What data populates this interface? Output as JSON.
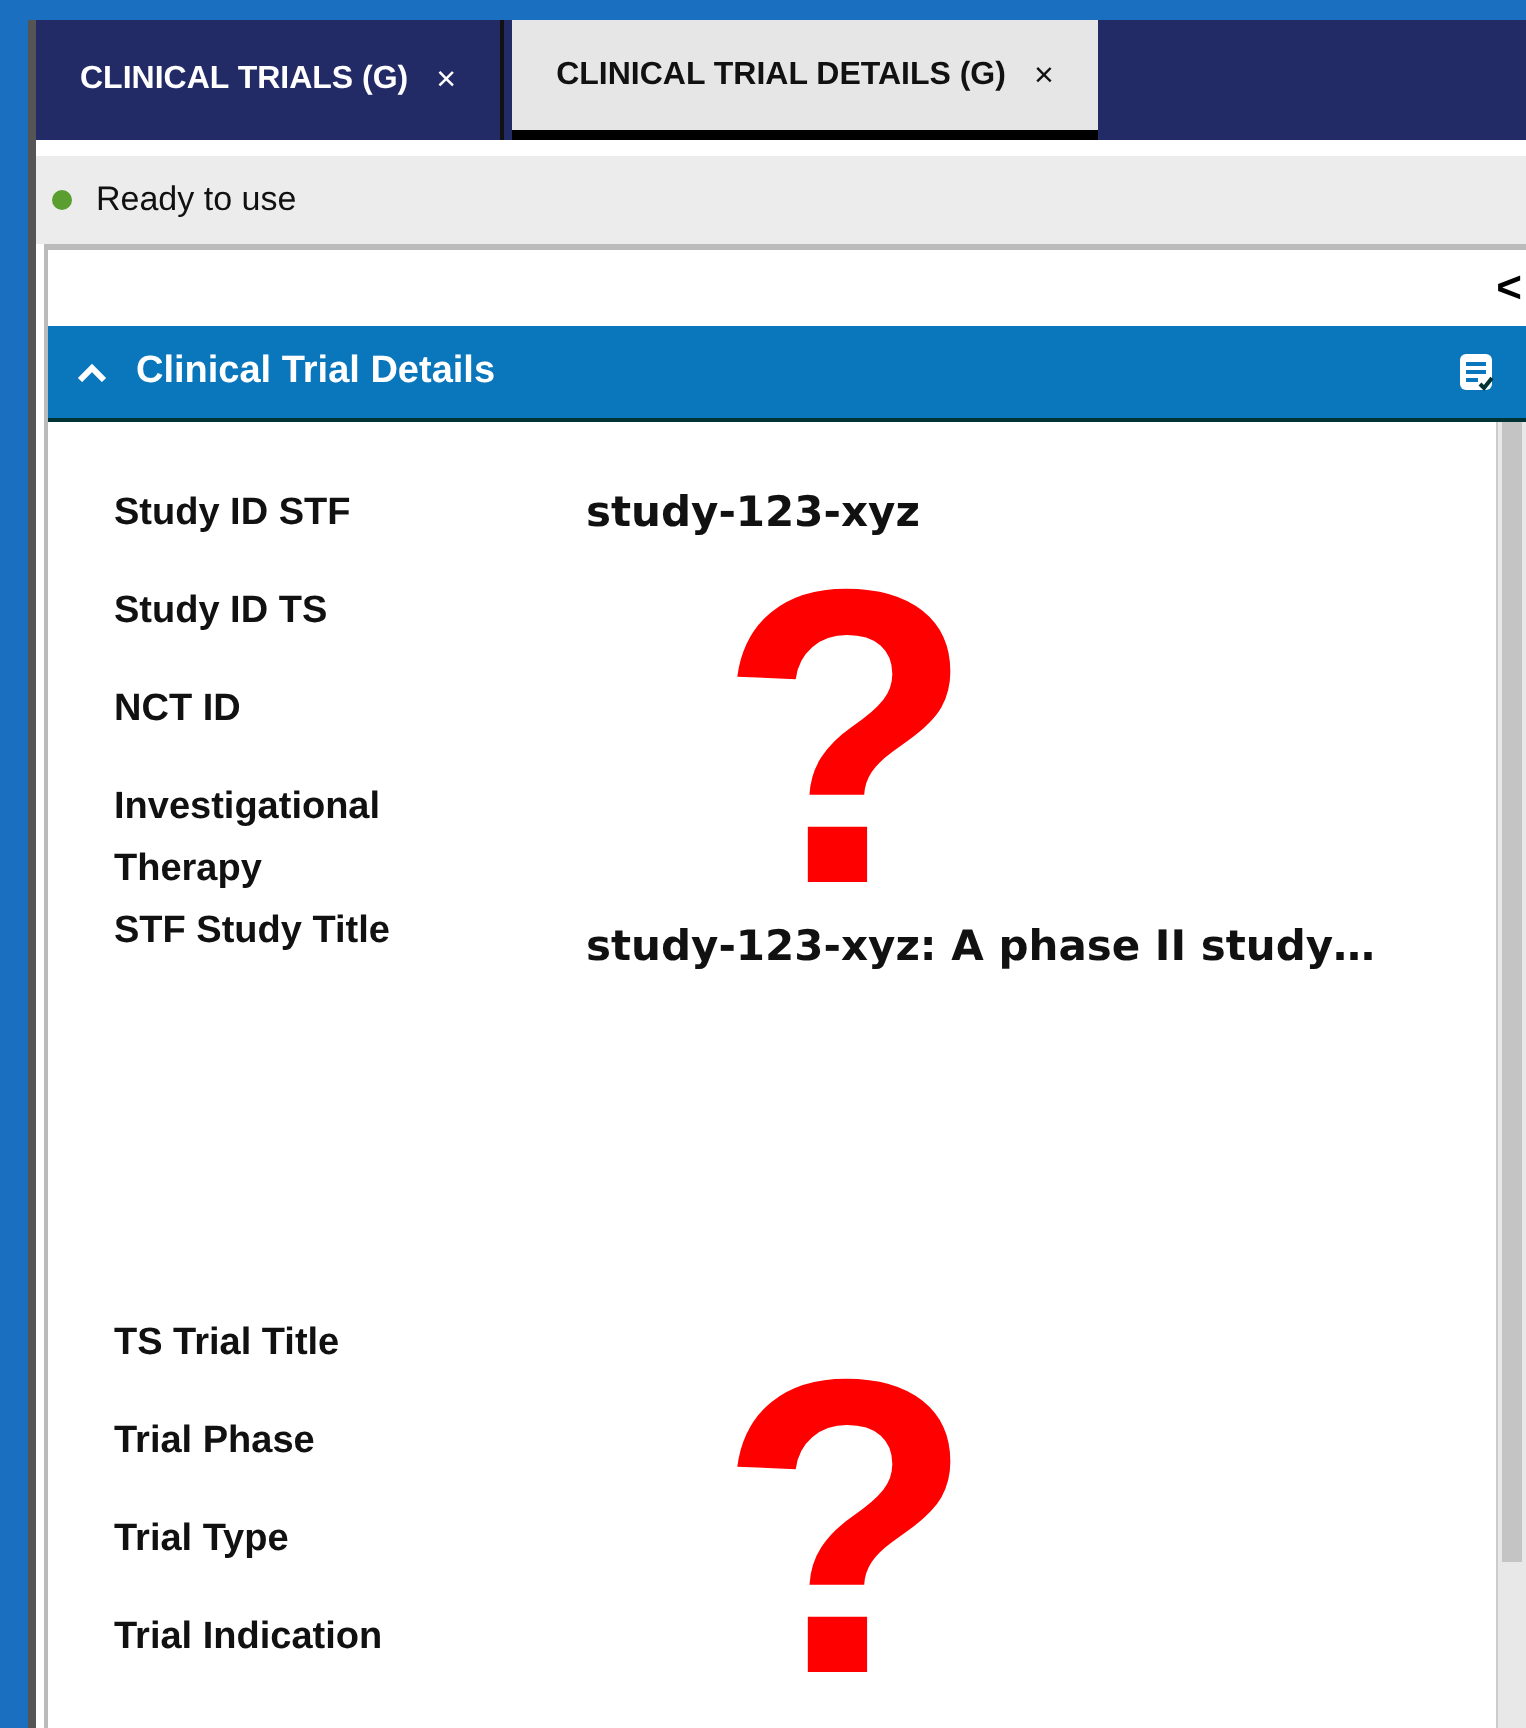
{
  "tabs": [
    {
      "label": "CLINICAL TRIALS (G)",
      "close": "×",
      "selected": false
    },
    {
      "label": "CLINICAL TRIAL DETAILS (G)",
      "close": "×",
      "selected": true
    }
  ],
  "status": {
    "text": "Ready to use",
    "color": "#5a9e2f"
  },
  "panel": {
    "collapse_glyph": "<",
    "title": "Clinical Trial Details",
    "expanded": true,
    "fields": [
      {
        "label": "Study ID STF",
        "value": "study-123-xyz",
        "kind": "short"
      },
      {
        "label": "Study ID TS",
        "kind": "short"
      },
      {
        "label": "NCT ID",
        "kind": "short"
      },
      {
        "label": "Investigational Therapy",
        "kind": "short"
      },
      {
        "label": "STF Study Title",
        "value": "study-123-xyz: A phase II study…",
        "kind": "long"
      },
      {
        "label": "TS Trial Title",
        "kind": "short"
      },
      {
        "label": "Trial Phase",
        "kind": "short"
      },
      {
        "label": "Trial Type",
        "kind": "short"
      },
      {
        "label": "Trial Indication",
        "kind": "short"
      }
    ]
  },
  "annotations": [
    {
      "text": "?",
      "color": "#ff0000"
    },
    {
      "text": "?",
      "color": "#ff0000"
    }
  ]
}
